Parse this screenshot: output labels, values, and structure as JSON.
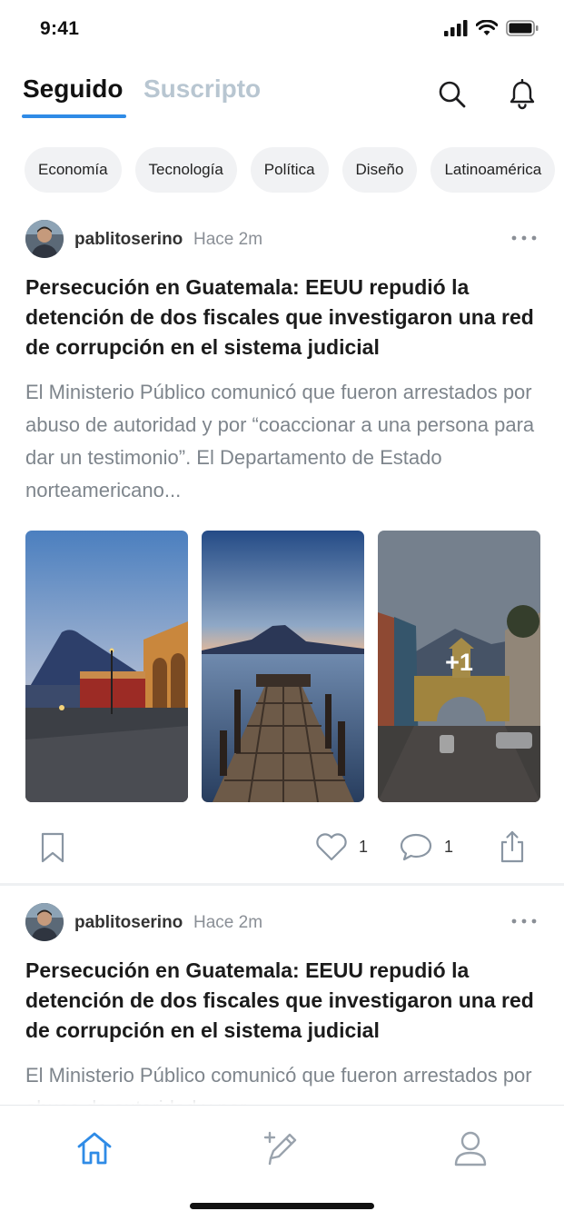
{
  "status": {
    "time": "9:41"
  },
  "header": {
    "tabs": [
      {
        "label": "Seguido",
        "active": true
      },
      {
        "label": "Suscripto",
        "active": false
      }
    ]
  },
  "categories": [
    "Economía",
    "Tecnología",
    "Política",
    "Diseño",
    "Latinoamérica"
  ],
  "posts": [
    {
      "author": "pablitoserino",
      "time": "Hace 2m",
      "title": "Persecución en Guatemala: EEUU repudió la detención de dos fiscales que investigaron una red de corrupción en el sistema judicial",
      "excerpt": "El Ministerio Público comunicó que fueron arrestados por abuso de autoridad y por “coaccionar a una persona para dar un testimonio”. El Departamento de Estado norteamericano...",
      "more_images": "+1",
      "likes": "1",
      "comments": "1"
    },
    {
      "author": "pablitoserino",
      "time": "Hace 2m",
      "title": "Persecución en Guatemala: EEUU repudió la detención de dos fiscales que investigaron una red de corrupción en el sistema judicial",
      "excerpt": "El Ministerio Público comunicó que fueron arrestados por abuso de autoridad y por"
    }
  ],
  "colors": {
    "accent": "#2f8be6",
    "inactive_tab": "#b8c6d1"
  },
  "icons": {
    "header": [
      "search-icon",
      "bell-icon"
    ],
    "post_actions": [
      "bookmark-icon",
      "heart-icon",
      "comment-icon",
      "share-icon"
    ],
    "nav": [
      "home-icon",
      "compose-icon",
      "profile-icon"
    ]
  }
}
